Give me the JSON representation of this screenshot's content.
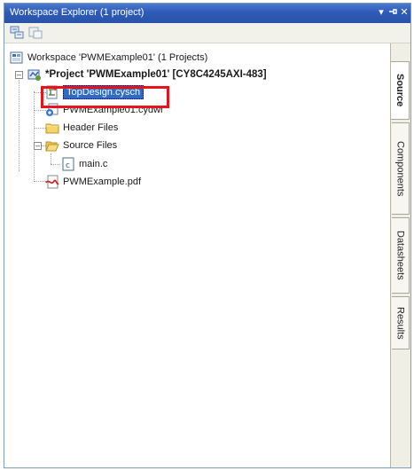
{
  "window": {
    "title": "Workspace Explorer (1 project)",
    "pin_glyph": "▾ ⊣",
    "close_glyph": "✕"
  },
  "toolbar": {
    "icons": [
      "properties-icon",
      "refresh-icon"
    ]
  },
  "tree": {
    "workspace_label": "Workspace 'PWMExample01' (1 Projects)",
    "project_label": "*Project 'PWMExample01' [CY8C4245AXI-483]",
    "items": [
      {
        "label": "TopDesign.cysch",
        "icon": "schematic-icon",
        "selected": true
      },
      {
        "label": "PWMExample01.cydwr",
        "icon": "design-wide-resources-icon"
      },
      {
        "label": "Header Files",
        "icon": "folder-icon"
      },
      {
        "label": "Source Files",
        "icon": "folder-open-icon"
      },
      {
        "label": "main.c",
        "icon": "c-file-icon"
      },
      {
        "label": "PWMExample.pdf",
        "icon": "pdf-icon"
      }
    ]
  },
  "side_tabs": [
    "Source",
    "Components",
    "Datasheets",
    "Results"
  ],
  "colors": {
    "titlebar": "#2e5bb8",
    "selection": "#316ac5",
    "highlight_box": "#e8141c"
  }
}
